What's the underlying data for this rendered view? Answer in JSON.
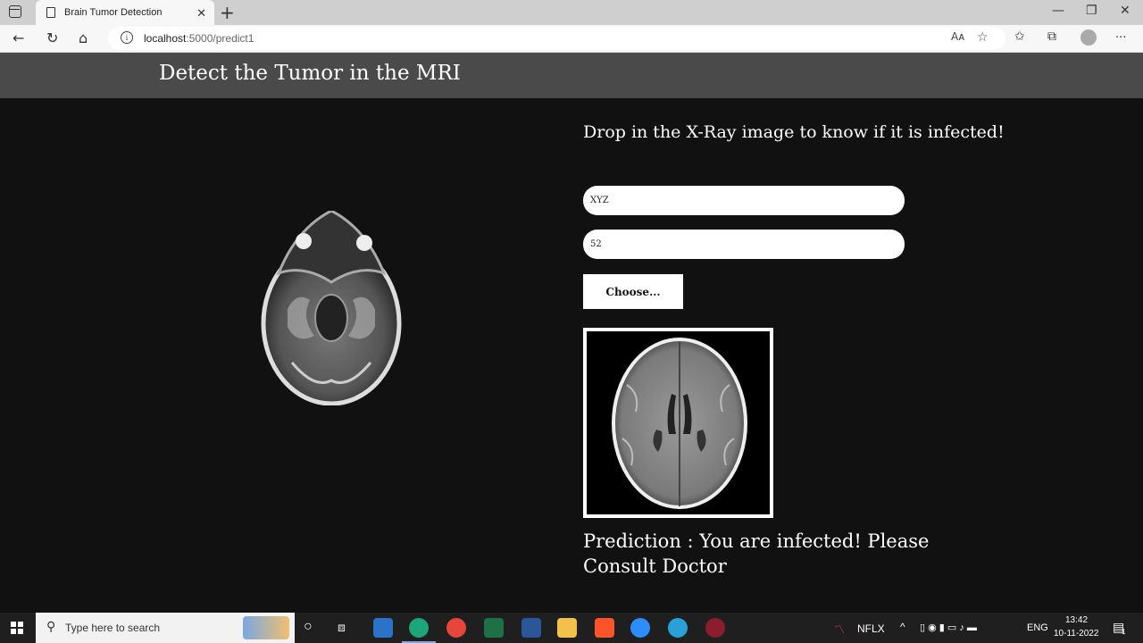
{
  "browser": {
    "tab_title": "Brain Tumor Detection",
    "tab_close": "✕",
    "new_tab": "+",
    "url_host": "localhost",
    "url_path": ":5000/predict1",
    "read_aloud": "Aᴀ",
    "more": "···"
  },
  "page": {
    "nav_title": "Detect the Tumor in the MRI",
    "heading": "Drop in the X-Ray image to know if it is infected!",
    "name_value": "XYZ",
    "age_value": "52",
    "choose_label": "Choose...",
    "prediction": "Prediction : You are infected! Please Consult Doctor"
  },
  "taskbar": {
    "search_placeholder": "Type here to search",
    "stock_label": "NFLX",
    "lang": "ENG",
    "time": "13:42",
    "date": "10-11-2022",
    "notif_count": "1"
  }
}
